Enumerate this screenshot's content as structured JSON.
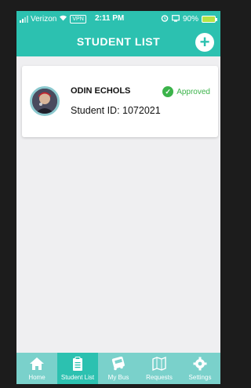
{
  "status_bar": {
    "carrier": "Verizon",
    "vpn": "VPN",
    "time": "2:11 PM",
    "battery": "90%"
  },
  "header": {
    "title": "STUDENT LIST",
    "add_label": "+"
  },
  "students": [
    {
      "name": "ODIN ECHOLS",
      "id_text": "Student ID: 1072021",
      "status": "Approved"
    }
  ],
  "tabs": [
    {
      "label": "Home",
      "icon": "home-icon"
    },
    {
      "label": "Student List",
      "icon": "clipboard-icon",
      "active": true
    },
    {
      "label": "My Bus",
      "icon": "bus-icon"
    },
    {
      "label": "Requests",
      "icon": "map-icon"
    },
    {
      "label": "Settings",
      "icon": "gear-icon"
    }
  ],
  "colors": {
    "primary": "#2cc1b0",
    "tabbar": "#7ad1cb",
    "approved": "#3bb34a",
    "background": "#efeff1"
  }
}
